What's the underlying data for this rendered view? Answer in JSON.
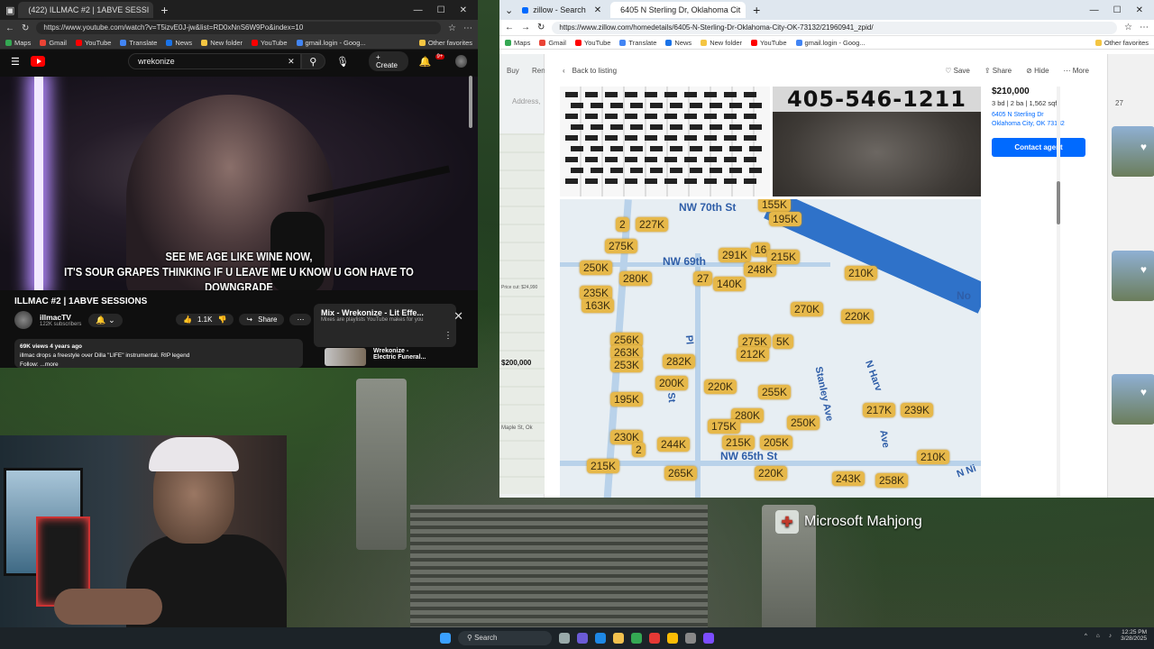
{
  "left_browser": {
    "tab_title": "(422) ILLMAC #2 | 1ABVE SESSI",
    "url": "https://www.youtube.com/watch?v=T5izvE0J-jw&list=RD0xNnS6W9Po&index=10",
    "bookmarks": [
      "Maps",
      "Gmail",
      "YouTube",
      "Translate",
      "News",
      "New folder",
      "YouTube",
      "gmail.login - Goog..."
    ],
    "other_favorites": "Other favorites"
  },
  "youtube": {
    "search_value": "wrekonize",
    "create_label": "Create",
    "notif_count": "9+",
    "subtitle_line1": "SEE ME AGE LIKE WINE NOW,",
    "subtitle_line2": "IT'S SOUR GRAPES THINKING IF U LEAVE ME U KNOW U GON HAVE TO DOWNGRADE",
    "video_title": "ILLMAC #2 | 1ABVE SESSIONS",
    "channel_name": "illmacTV",
    "subscribers": "122K subscribers",
    "likes": "1.1K",
    "share_label": "Share",
    "views_line": "69K views  4 years ago",
    "desc_line1": "illmac drops a freestyle over Dilla \"LIFE\" instrumental. RIP legend",
    "desc_line2": "Follow: ...more",
    "mix_title": "Mix - Wrekonize - Lit Effe...",
    "mix_sub": "Mixes are playlists YouTube makes for you",
    "next_title_1": "Wrekonize -",
    "next_title_2": "Electric Funeral..."
  },
  "right_browser": {
    "tab1_title": "zillow - Search",
    "tab2_title": "6405 N Sterling Dr, Oklahoma Cit",
    "url": "https://www.zillow.com/homedetails/6405-N-Sterling-Dr-Oklahoma-City-OK-73132/21960941_zpid/",
    "bookmarks": [
      "Maps",
      "Gmail",
      "YouTube",
      "Translate",
      "News",
      "New folder",
      "YouTube",
      "gmail.login - Goog..."
    ],
    "other_favorites": "Other favorites"
  },
  "zillow": {
    "sidebar_buy": "Buy",
    "sidebar_rent": "Ren",
    "sidebar_address": "Address,",
    "sidebar_price1": "Price cut: $24,990",
    "sidebar_price2": "$200,000",
    "sidebar_addr2": "Maple St, Ok",
    "right_count": "27",
    "back_label": "Back to listing",
    "save_label": "Save",
    "share_label": "Share",
    "hide_label": "Hide",
    "more_label": "More",
    "phone_sign": "405-546-1211",
    "price": "$210,000",
    "beds": "3 bd",
    "baths": "2 ba",
    "sqft": "1,562 sqft",
    "address_line1": "6405 N Sterling Dr",
    "address_line2": "Oklahoma City, OK 73132",
    "contact_label": "Contact agent",
    "map_streets": [
      "NW 70th St",
      "NW 69th",
      "Stanley Ave",
      "N Harv",
      "Ave",
      "NW 65th St",
      "No",
      "Pl",
      "St",
      "N Ni"
    ],
    "map_prices": [
      "155K",
      "2",
      "227K",
      "195K",
      "275K",
      "291K",
      "16",
      "248K",
      "215K",
      "250K",
      "280K",
      "27",
      "140K",
      "210K",
      "235K",
      "163K",
      "270K",
      "220K",
      "256K",
      "263K",
      "253K",
      "275K",
      "5K",
      "212K",
      "282K",
      "200K",
      "220K",
      "255K",
      "195K",
      "217K",
      "239K",
      "280K",
      "175K",
      "250K",
      "230K",
      "215K",
      "205K",
      "2",
      "244K",
      "210K",
      "215K",
      "265K",
      "220K",
      "243K",
      "258K"
    ]
  },
  "desktop": {
    "watermark": "Microsoft Mahjong"
  },
  "taskbar": {
    "search_label": "Search",
    "time": "12:25 PM",
    "date": "3/28/2025"
  }
}
